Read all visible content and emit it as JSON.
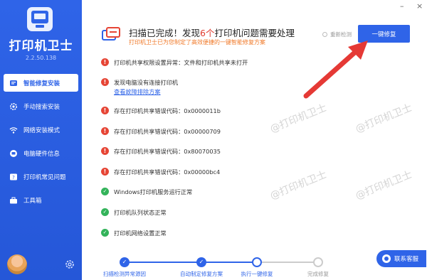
{
  "app": {
    "name": "打印机卫士",
    "version": "2.2.50.138"
  },
  "sidebar": {
    "items": [
      {
        "label": "智能修复安装",
        "icon": "repair-icon",
        "active": true
      },
      {
        "label": "手动搜索安装",
        "icon": "gear-icon",
        "active": false
      },
      {
        "label": "网络安装模式",
        "icon": "network-icon",
        "active": false
      },
      {
        "label": "电脑硬件信息",
        "icon": "hardware-icon",
        "active": false
      },
      {
        "label": "打印机常见问题",
        "icon": "help-icon",
        "active": false
      },
      {
        "label": "工具箱",
        "icon": "toolbox-icon",
        "active": false
      }
    ]
  },
  "window": {
    "minimize": "–",
    "close": "×"
  },
  "header": {
    "title_prefix": "扫描已完成！发现",
    "title_count": "6个",
    "title_suffix": "打印机问题需要处理",
    "subtitle": "打印机卫士已为您制定了高效便捷的一键智能修复方案",
    "rescan_label": "重新检测",
    "fix_button": "一键修复"
  },
  "issues": [
    {
      "status": "warn",
      "text": "打印机共享权限设置异常：文件和打印机共享未打开"
    },
    {
      "status": "warn",
      "text": "发现电脑没有连接打印机",
      "link": "查看故障排除方案"
    },
    {
      "status": "warn",
      "text": "存在打印机共享错误代码：0x0000011b"
    },
    {
      "status": "warn",
      "text": "存在打印机共享错误代码：0x00000709"
    },
    {
      "status": "warn",
      "text": "存在打印机共享错误代码：0x80070035"
    },
    {
      "status": "warn",
      "text": "存在打印机共享错误代码：0x00000bc4"
    },
    {
      "status": "ok",
      "text": "Windows打印机服务运行正常"
    },
    {
      "status": "ok",
      "text": "打印机队列状态正常"
    },
    {
      "status": "ok",
      "text": "打印机网络设置正常"
    }
  ],
  "watermark": "@打印机卫士",
  "contact": {
    "label": "联系客服"
  },
  "steps": [
    {
      "label": "扫描检测异常源因",
      "state": "done"
    },
    {
      "label": "自动制定修复方案",
      "state": "done"
    },
    {
      "label": "执行一键修复",
      "state": "current"
    },
    {
      "label": "完成修复",
      "state": "todo"
    }
  ],
  "colors": {
    "brand": "#2f64e8",
    "warning": "#e64535",
    "ok": "#33b35a",
    "highlight": "#e03b2e",
    "arrow": "#e53935"
  }
}
